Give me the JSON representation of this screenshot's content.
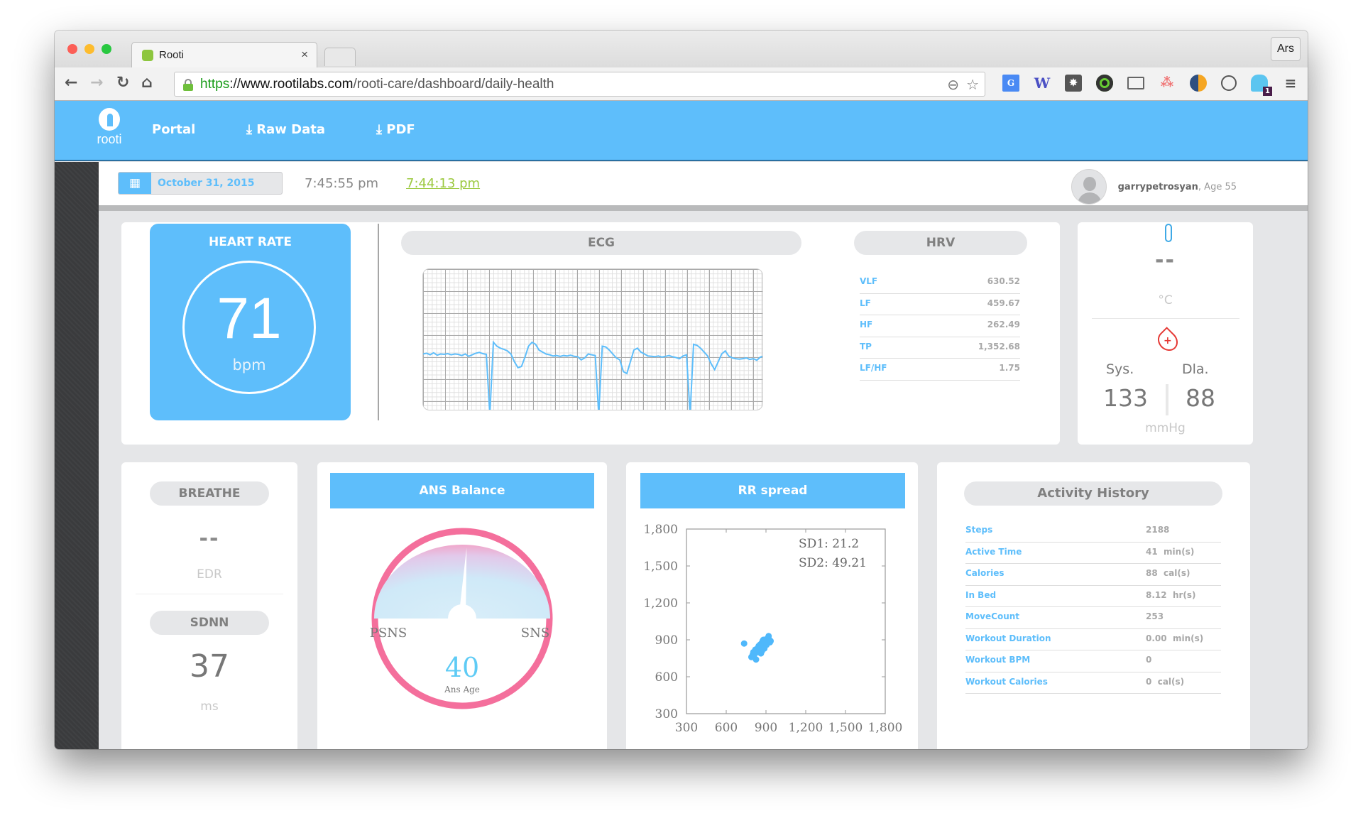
{
  "browser": {
    "tab_title": "Rooti",
    "tab_close": "×",
    "profile_label": "Ars",
    "url_scheme": "https",
    "url_sep": "://",
    "url_host": "www.rootilabs.com",
    "url_path": "/rooti-care/dashboard/daily-health",
    "nav": {
      "back": "←",
      "forward": "→",
      "reload": "↻",
      "home": "⌂"
    },
    "extensions": [
      "google-translate",
      "wikipedia",
      "bomb-extension",
      "camera-extension",
      "cast",
      "asana",
      "simplenote",
      "sync-extension",
      "ghostery",
      "menu"
    ],
    "ghostery_badge": "1"
  },
  "app": {
    "logo_text": "rooti",
    "nav": [
      {
        "label": "Portal",
        "icon": ""
      },
      {
        "label": "Raw Data",
        "icon": "download-icon"
      },
      {
        "label": "PDF",
        "icon": "download-icon"
      }
    ],
    "download_glyph": "⤓",
    "date": "October 31, 2015",
    "time_current": "7:45:55 pm",
    "time_measured": "7:44:13 pm",
    "user": {
      "name": "garrypetrosyan",
      "age_label": ", Age 55"
    }
  },
  "heart_rate": {
    "title": "HEART RATE",
    "value": "71",
    "unit": "bpm"
  },
  "ecg": {
    "title": "ECG"
  },
  "hrv": {
    "title": "HRV",
    "rows": [
      {
        "key": "VLF",
        "value": "630.52"
      },
      {
        "key": "LF",
        "value": "459.67"
      },
      {
        "key": "HF",
        "value": "262.49"
      },
      {
        "key": "TP",
        "value": "1,352.68"
      },
      {
        "key": "LF/HF",
        "value": "1.75"
      }
    ]
  },
  "temperature": {
    "value": "--",
    "unit": "°C"
  },
  "blood_pressure": {
    "sys_label": "Sys.",
    "dia_label": "Dla.",
    "sys": "133",
    "dia": "88",
    "unit": "mmHg"
  },
  "breathe": {
    "title": "BREATHE",
    "value": "--",
    "unit": "EDR"
  },
  "sdnn": {
    "title": "SDNN",
    "value": "37",
    "unit": "ms"
  },
  "ans": {
    "title": "ANS Balance",
    "left_label": "PSNS",
    "right_label": "SNS",
    "value": "40",
    "value_label": "Ans Age",
    "needle_fraction": 0.52
  },
  "rr_spread": {
    "title": "RR spread",
    "sd1": "SD1: 21.2",
    "sd2": "SD2: 49.21"
  },
  "activity": {
    "title": "Activity History",
    "rows": [
      {
        "key": "Steps",
        "value": "2188"
      },
      {
        "key": "Active Time",
        "value": "41  min(s)"
      },
      {
        "key": "Calories",
        "value": "88  cal(s)"
      },
      {
        "key": "In Bed",
        "value": "8.12  hr(s)"
      },
      {
        "key": "MoveCount",
        "value": "253"
      },
      {
        "key": "Workout Duration",
        "value": "0.00  min(s)"
      },
      {
        "key": "Workout BPM",
        "value": "0"
      },
      {
        "key": "Workout Calories",
        "value": "0  cal(s)"
      }
    ]
  },
  "colors": {
    "brand": "#5ebefb",
    "accent_green": "#9cc93f",
    "ans_ring": "#f46f9c",
    "bp_icon": "#e53935"
  },
  "chart_data": [
    {
      "type": "scatter",
      "title": "RR spread",
      "xlabel": "",
      "ylabel": "",
      "xlim": [
        300,
        1800
      ],
      "ylim": [
        300,
        1800
      ],
      "xticks": [
        "300",
        "600",
        "900",
        "1,200",
        "1,500",
        "1,800"
      ],
      "yticks": [
        "1,800",
        "1,500",
        "1,200",
        "900",
        "600",
        "300"
      ],
      "annotations": [
        "SD1: 21.2",
        "SD2: 49.21"
      ],
      "points": [
        [
          735,
          870
        ],
        [
          790,
          760
        ],
        [
          800,
          780
        ],
        [
          805,
          800
        ],
        [
          815,
          790
        ],
        [
          820,
          820
        ],
        [
          825,
          740
        ],
        [
          830,
          810
        ],
        [
          835,
          830
        ],
        [
          840,
          800
        ],
        [
          845,
          850
        ],
        [
          850,
          820
        ],
        [
          855,
          860
        ],
        [
          860,
          830
        ],
        [
          862,
          790
        ],
        [
          865,
          870
        ],
        [
          870,
          850
        ],
        [
          875,
          890
        ],
        [
          878,
          840
        ],
        [
          880,
          860
        ],
        [
          885,
          880
        ],
        [
          888,
          830
        ],
        [
          890,
          900
        ],
        [
          895,
          870
        ],
        [
          900,
          880
        ],
        [
          905,
          860
        ],
        [
          910,
          910
        ],
        [
          915,
          890
        ],
        [
          920,
          930
        ],
        [
          925,
          900
        ],
        [
          930,
          880
        ],
        [
          935,
          890
        ],
        [
          850,
          800
        ],
        [
          810,
          770
        ],
        [
          870,
          810
        ],
        [
          880,
          900
        ]
      ]
    },
    {
      "type": "line",
      "title": "ECG",
      "xlabel": "",
      "ylabel": "",
      "grid": true,
      "values": [
        0.1,
        0.12,
        0.08,
        0.13,
        0.07,
        0.1,
        0.09,
        0.11,
        0.08,
        0.1,
        0.09,
        0.06,
        0.1,
        0.04,
        0.08,
        0.12,
        0.14,
        0.11,
        0.09,
        -1.5,
        0.4,
        0.3,
        0.25,
        0.22,
        0.18,
        0.1,
        -0.1,
        -0.25,
        -0.22,
        0.02,
        0.3,
        0.4,
        0.35,
        0.2,
        0.15,
        0.1,
        0.08,
        0.05,
        0.06,
        0.04,
        0.06,
        0.05,
        0.07,
        0.04,
        0.03,
        -0.05,
        0.0,
        0.1,
        0.08,
        0.06,
        -1.5,
        0.3,
        0.28,
        0.2,
        0.1,
        0.0,
        -0.05,
        -0.35,
        -0.4,
        -0.1,
        0.2,
        0.25,
        0.15,
        0.1,
        0.05,
        0.04,
        0.03,
        0.05,
        0.02,
        0.04,
        0.06,
        0.03,
        0.01,
        -0.02,
        0.05,
        0.08,
        -1.5,
        0.35,
        0.32,
        0.25,
        0.15,
        0.05,
        -0.15,
        -0.3,
        -0.1,
        0.1,
        0.18,
        0.05,
        0.0,
        -0.02,
        -0.03,
        -0.02,
        0.0,
        -0.04,
        -0.02,
        -0.06,
        0.02,
        0.05
      ]
    }
  ]
}
